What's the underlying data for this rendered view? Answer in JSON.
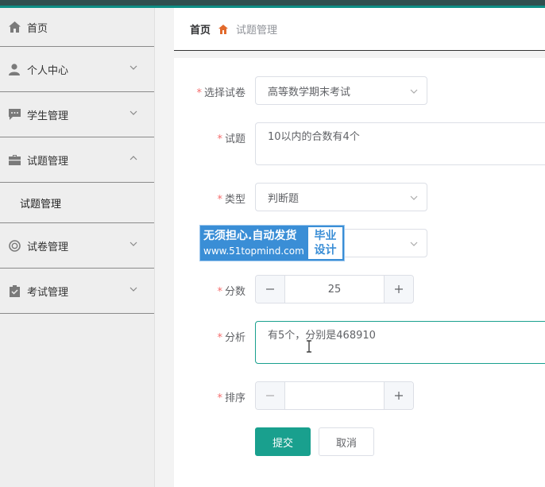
{
  "sidebar": {
    "items": [
      {
        "label": "首页",
        "icon": "home-icon"
      },
      {
        "label": "个人中心",
        "icon": "user-icon"
      },
      {
        "label": "学生管理",
        "icon": "chat-icon"
      },
      {
        "label": "试题管理",
        "icon": "briefcase-icon"
      },
      {
        "label": "试卷管理",
        "icon": "ring-icon"
      },
      {
        "label": "考试管理",
        "icon": "clipboard-icon"
      }
    ],
    "submenu_label": "试题管理"
  },
  "header": {
    "home": "首页",
    "current": "试题管理"
  },
  "form": {
    "paper": {
      "label": "选择试卷",
      "value": "高等数学期末考试"
    },
    "question": {
      "label": "试题",
      "value": "10以内的合数有4个"
    },
    "type": {
      "label": "类型",
      "value": "判断题"
    },
    "score": {
      "label": "分数",
      "value": "25"
    },
    "analysis": {
      "label": "分析",
      "value": "有5个，分别是468910"
    },
    "order": {
      "label": "排序",
      "value": ""
    },
    "required_mark": "*",
    "submit": "提交",
    "cancel": "取消"
  },
  "watermark": {
    "line1": "无须担心.自动发货",
    "line2": "www.51topmind.com",
    "right1": "毕业",
    "right2": "设计"
  },
  "colors": {
    "accent": "#19a08e",
    "required": "#f56c6c",
    "topbar": "#2f4f4f"
  }
}
